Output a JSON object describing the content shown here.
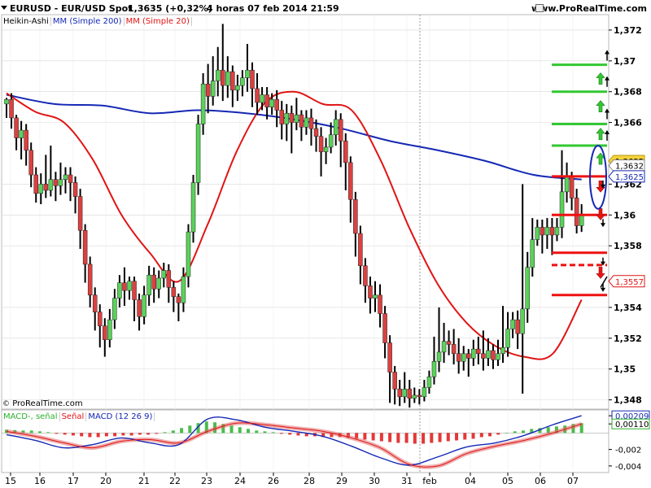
{
  "header": {
    "symbol": "EURUSD - EUR/USD Spot",
    "price": "1,3635 (+0,32%)",
    "timeframe": "4 horas  07 feb 2014 21:59",
    "source": "www.ProRealTime.com"
  },
  "legend": {
    "type_label": "Heikin-Ashi",
    "ma200_label": "MM (Simple 200)",
    "ma20_label": "MM (Simple 20)",
    "ma200_color": "#1428b4",
    "ma20_color": "#e01414"
  },
  "macd_legend": {
    "line_label": "MACD-, señal",
    "signal_label": "Señal",
    "macd_label": "MACD (12 26 9)"
  },
  "copyright": "ProRealTime.com",
  "colors": {
    "bull": "#5ad25a",
    "bear": "#dc4040",
    "wick": "#000000",
    "grid": "#d8d8d8",
    "level_green": "#32c832",
    "level_red": "#ee1111"
  },
  "chart_data": [
    {
      "type": "candlestick",
      "title": "EURUSD - EUR/USD Spot",
      "y_ticks": [
        "1,372",
        "1,37",
        "1,368",
        "1,366",
        "1,362",
        "1,36",
        "1,358",
        "1,354",
        "1,352",
        "1,35",
        "1,348"
      ],
      "x_ticks": [
        "15",
        "16",
        "17",
        "20",
        "21",
        "22",
        "23",
        "24",
        "26",
        "28",
        "29",
        "30",
        "31",
        "feb",
        "04",
        "05",
        "06",
        "07"
      ],
      "ylim": [
        1.3474,
        1.373
      ],
      "price_labels": [
        {
          "text": "1,3635",
          "value": 1.3635,
          "style": "current"
        },
        {
          "text": "1,3632",
          "value": 1.3632,
          "style": "plain"
        },
        {
          "text": "1,3625",
          "value": 1.3625,
          "style": "blue"
        },
        {
          "text": "1,3557",
          "value": 1.3557,
          "style": "red"
        }
      ],
      "ohlc": [
        [
          1.3672,
          1.3675,
          1.3663,
          1.3676
        ],
        [
          1.3675,
          1.3663,
          1.3656,
          1.3679
        ],
        [
          1.3663,
          1.365,
          1.3642,
          1.3665
        ],
        [
          1.365,
          1.3655,
          1.3636,
          1.3661
        ],
        [
          1.3655,
          1.3642,
          1.3632,
          1.3659
        ],
        [
          1.3642,
          1.3626,
          1.3618,
          1.3647
        ],
        [
          1.3626,
          1.3614,
          1.3608,
          1.3631
        ],
        [
          1.3614,
          1.362,
          1.3607,
          1.3627
        ],
        [
          1.362,
          1.3616,
          1.3611,
          1.3639
        ],
        [
          1.3616,
          1.3623,
          1.3612,
          1.3645
        ],
        [
          1.3623,
          1.3619,
          1.3609,
          1.3628
        ],
        [
          1.3619,
          1.3623,
          1.3613,
          1.3634
        ],
        [
          1.3623,
          1.3626,
          1.3614,
          1.3631
        ],
        [
          1.3626,
          1.3621,
          1.3609,
          1.3631
        ],
        [
          1.3621,
          1.3612,
          1.3601,
          1.3625
        ],
        [
          1.3612,
          1.359,
          1.3578,
          1.3617
        ],
        [
          1.359,
          1.3568,
          1.3556,
          1.3594
        ],
        [
          1.3568,
          1.3548,
          1.354,
          1.3573
        ],
        [
          1.3548,
          1.3537,
          1.3525,
          1.3553
        ],
        [
          1.3537,
          1.3528,
          1.3514,
          1.3542
        ],
        [
          1.3528,
          1.3519,
          1.3508,
          1.3533
        ],
        [
          1.3519,
          1.3532,
          1.3514,
          1.3539
        ],
        [
          1.3532,
          1.3546,
          1.3526,
          1.3552
        ],
        [
          1.3546,
          1.3556,
          1.354,
          1.3561
        ],
        [
          1.3556,
          1.3551,
          1.3541,
          1.3566
        ],
        [
          1.3551,
          1.3557,
          1.3545,
          1.356
        ],
        [
          1.3557,
          1.3545,
          1.3531,
          1.356
        ],
        [
          1.3545,
          1.3534,
          1.3525,
          1.3549
        ],
        [
          1.3534,
          1.3548,
          1.3529,
          1.3554
        ],
        [
          1.3548,
          1.3561,
          1.3541,
          1.3567
        ],
        [
          1.3561,
          1.3552,
          1.3543,
          1.3566
        ],
        [
          1.3552,
          1.3559,
          1.3546,
          1.3564
        ],
        [
          1.3559,
          1.3564,
          1.3553,
          1.3569
        ],
        [
          1.3564,
          1.3553,
          1.3543,
          1.3568
        ],
        [
          1.3553,
          1.3547,
          1.3537,
          1.3557
        ],
        [
          1.3547,
          1.3543,
          1.3531,
          1.3549
        ],
        [
          1.3543,
          1.356,
          1.3537,
          1.3566
        ],
        [
          1.356,
          1.3589,
          1.3553,
          1.3594
        ],
        [
          1.3589,
          1.3621,
          1.3582,
          1.3626
        ],
        [
          1.3621,
          1.3659,
          1.3613,
          1.3665
        ],
        [
          1.3659,
          1.3685,
          1.3652,
          1.3692
        ],
        [
          1.3685,
          1.3677,
          1.3666,
          1.3698
        ],
        [
          1.3677,
          1.3687,
          1.3671,
          1.3703
        ],
        [
          1.3687,
          1.3694,
          1.3677,
          1.3709
        ],
        [
          1.3694,
          1.3684,
          1.3674,
          1.3724
        ],
        [
          1.3684,
          1.3693,
          1.3676,
          1.3703
        ],
        [
          1.3693,
          1.3681,
          1.367,
          1.3697
        ],
        [
          1.3681,
          1.3684,
          1.3674,
          1.3691
        ],
        [
          1.3684,
          1.3689,
          1.3677,
          1.3694
        ],
        [
          1.3689,
          1.3694,
          1.368,
          1.3711
        ],
        [
          1.3694,
          1.3682,
          1.367,
          1.3699
        ],
        [
          1.3682,
          1.3673,
          1.3665,
          1.3692
        ],
        [
          1.3673,
          1.3678,
          1.3668,
          1.3683
        ],
        [
          1.3678,
          1.367,
          1.3662,
          1.3683
        ],
        [
          1.367,
          1.3675,
          1.3665,
          1.3679
        ],
        [
          1.3675,
          1.3668,
          1.3657,
          1.3681
        ],
        [
          1.3668,
          1.3659,
          1.3649,
          1.3674
        ],
        [
          1.3659,
          1.3666,
          1.3648,
          1.3672
        ],
        [
          1.3666,
          1.366,
          1.364,
          1.3671
        ],
        [
          1.366,
          1.3665,
          1.3655,
          1.3676
        ],
        [
          1.3665,
          1.3657,
          1.3648,
          1.3668
        ],
        [
          1.3657,
          1.3663,
          1.3652,
          1.3668
        ],
        [
          1.3663,
          1.3656,
          1.3645,
          1.3669
        ],
        [
          1.3656,
          1.3651,
          1.3641,
          1.3662
        ],
        [
          1.3651,
          1.3641,
          1.3625,
          1.3657
        ],
        [
          1.3641,
          1.3644,
          1.3633,
          1.365
        ],
        [
          1.3644,
          1.3652,
          1.364,
          1.366
        ],
        [
          1.3652,
          1.3662,
          1.3645,
          1.3668
        ],
        [
          1.3662,
          1.3648,
          1.3631,
          1.3666
        ],
        [
          1.3648,
          1.3634,
          1.3616,
          1.3653
        ],
        [
          1.3634,
          1.361,
          1.3595,
          1.3638
        ],
        [
          1.361,
          1.3588,
          1.3573,
          1.3615
        ],
        [
          1.3588,
          1.3567,
          1.3555,
          1.3593
        ],
        [
          1.3567,
          1.3554,
          1.3543,
          1.3572
        ],
        [
          1.3554,
          1.3546,
          1.3536,
          1.356
        ],
        [
          1.3546,
          1.3548,
          1.3537,
          1.3557
        ],
        [
          1.3548,
          1.3536,
          1.3527,
          1.3555
        ],
        [
          1.3536,
          1.3517,
          1.3507,
          1.3541
        ],
        [
          1.3517,
          1.3498,
          1.3478,
          1.3522
        ],
        [
          1.3498,
          1.3487,
          1.3477,
          1.3502
        ],
        [
          1.3487,
          1.3482,
          1.3476,
          1.3493
        ],
        [
          1.3482,
          1.3487,
          1.3478,
          1.3498
        ],
        [
          1.3487,
          1.3481,
          1.3475,
          1.3493
        ],
        [
          1.3481,
          1.3483,
          1.3478,
          1.3488
        ],
        [
          1.3483,
          1.3482,
          1.3477,
          1.3487
        ],
        [
          1.3482,
          1.3488,
          1.3479,
          1.3493
        ],
        [
          1.3488,
          1.3495,
          1.3484,
          1.3499
        ],
        [
          1.3495,
          1.3505,
          1.349,
          1.3521
        ],
        [
          1.3505,
          1.3511,
          1.3498,
          1.354
        ],
        [
          1.3511,
          1.3518,
          1.3504,
          1.353
        ],
        [
          1.3518,
          1.3516,
          1.3509,
          1.3525
        ],
        [
          1.3516,
          1.351,
          1.3503,
          1.3526
        ],
        [
          1.351,
          1.3505,
          1.3497,
          1.352
        ],
        [
          1.3505,
          1.351,
          1.3499,
          1.3515
        ],
        [
          1.351,
          1.3507,
          1.3495,
          1.3513
        ],
        [
          1.3507,
          1.3513,
          1.3502,
          1.3519
        ],
        [
          1.3513,
          1.351,
          1.3503,
          1.3521
        ],
        [
          1.351,
          1.3507,
          1.3499,
          1.3525
        ],
        [
          1.3507,
          1.3512,
          1.3502,
          1.352
        ],
        [
          1.3512,
          1.3506,
          1.35,
          1.3516
        ],
        [
          1.3506,
          1.351,
          1.3502,
          1.3519
        ],
        [
          1.351,
          1.3514,
          1.3504,
          1.3541
        ],
        [
          1.3514,
          1.3526,
          1.3508,
          1.3537
        ],
        [
          1.3526,
          1.3532,
          1.352,
          1.3537
        ],
        [
          1.3532,
          1.3523,
          1.3513,
          1.3538
        ],
        [
          1.3523,
          1.3539,
          1.3484,
          1.362
        ],
        [
          1.3539,
          1.3566,
          1.353,
          1.3576
        ],
        [
          1.3566,
          1.3584,
          1.356,
          1.3598
        ],
        [
          1.3584,
          1.3592,
          1.358,
          1.3597
        ],
        [
          1.3592,
          1.3587,
          1.3575,
          1.3597
        ],
        [
          1.3587,
          1.3592,
          1.3578,
          1.3598
        ],
        [
          1.3592,
          1.3587,
          1.3574,
          1.3598
        ],
        [
          1.3587,
          1.3592,
          1.3583,
          1.3598
        ],
        [
          1.3592,
          1.3615,
          1.3585,
          1.3642
        ],
        [
          1.3615,
          1.3625,
          1.3608,
          1.3634
        ],
        [
          1.3625,
          1.3611,
          1.3603,
          1.3628
        ],
        [
          1.3611,
          1.3593,
          1.3588,
          1.3617
        ],
        [
          1.3593,
          1.36,
          1.3589,
          1.3607
        ]
      ],
      "ma200_nodes": [
        1.3678,
        1.3672,
        1.3671,
        1.3666,
        1.3668,
        1.3666,
        1.3662,
        1.3656,
        1.3648,
        1.3642,
        1.3635,
        1.3626,
        1.3623
      ],
      "ma20_nodes": [
        1.3679,
        1.3667,
        1.366,
        1.3636,
        1.36,
        1.3575,
        1.3557,
        1.3594,
        1.3641,
        1.3673,
        1.368,
        1.3672,
        1.3668,
        1.3636,
        1.3592,
        1.3555,
        1.353,
        1.3515,
        1.3508,
        1.351,
        1.3545
      ],
      "levels": [
        {
          "value": 1.36975,
          "color": "green",
          "dash": false
        },
        {
          "value": 1.368,
          "color": "green",
          "dash": false
        },
        {
          "value": 1.3659,
          "color": "green",
          "dash": false
        },
        {
          "value": 1.3645,
          "color": "green",
          "dash": false
        },
        {
          "value": 1.3625,
          "color": "red",
          "dash": false
        },
        {
          "value": 1.36,
          "color": "red",
          "dash": false
        },
        {
          "value": 1.35755,
          "color": "red",
          "dash": false
        },
        {
          "value": 1.35675,
          "color": "red",
          "dash": true
        },
        {
          "value": 1.3548,
          "color": "red",
          "dash": false
        }
      ]
    },
    {
      "type": "bar",
      "title": "MACD (12 26 9)",
      "y_ticks": [
        "0,00209",
        "0,00110",
        "-0,002",
        "-0,004"
      ],
      "ylim": [
        -0.0048,
        0.0028
      ],
      "histogram": [
        0.0004,
        0.00035,
        0.0003,
        0.0003,
        0.0002,
        0.0001,
        -0.0001,
        -0.0002,
        -0.0003,
        -0.0004,
        -0.0005,
        -0.0005,
        -0.0004,
        -0.0004,
        -0.0003,
        -0.0003,
        -0.0002,
        -0.0002,
        -0.0001,
        0.0001,
        0.0003,
        0.0006,
        0.0009,
        0.0012,
        0.0014,
        0.0013,
        0.0011,
        0.0009,
        0.0007,
        0.0005,
        0.0003,
        0.0002,
        0.0001,
        -0.0001,
        -0.0002,
        -0.0003,
        -0.0004,
        -0.0004,
        -0.0005,
        -0.0005,
        -0.0005,
        -0.0006,
        -0.0007,
        -0.0008,
        -0.0009,
        -0.001,
        -0.0011,
        -0.0012,
        -0.0012,
        -0.0013,
        -0.0013,
        -0.0012,
        -0.0011,
        -0.001,
        -0.0009,
        -0.0008,
        -0.0007,
        -0.0005,
        -0.0004,
        -0.0002,
        0.0,
        0.0002,
        0.0003,
        0.0005,
        0.0006,
        0.0007,
        0.0008,
        0.0009,
        0.0011,
        0.0012
      ],
      "macd_nodes": [
        -0.0002,
        -0.0009,
        -0.0018,
        -0.0014,
        -0.0006,
        -0.0012,
        -0.0014,
        0.0017,
        0.0016,
        0.0007,
        0.0002,
        -0.0004,
        -0.0016,
        -0.003,
        -0.0039,
        -0.0029,
        -0.0017,
        -0.0012,
        -0.0003,
        0.001,
        0.0021
      ],
      "signal_nodes": [
        0.0002,
        -0.0004,
        -0.0012,
        -0.0018,
        -0.001,
        -0.0008,
        -0.0012,
        0.0002,
        0.0012,
        0.001,
        0.0006,
        0.0002,
        -0.0006,
        -0.0018,
        -0.0038,
        -0.004,
        -0.0025,
        -0.0016,
        -0.0009,
        0.0,
        0.0011
      ]
    }
  ]
}
